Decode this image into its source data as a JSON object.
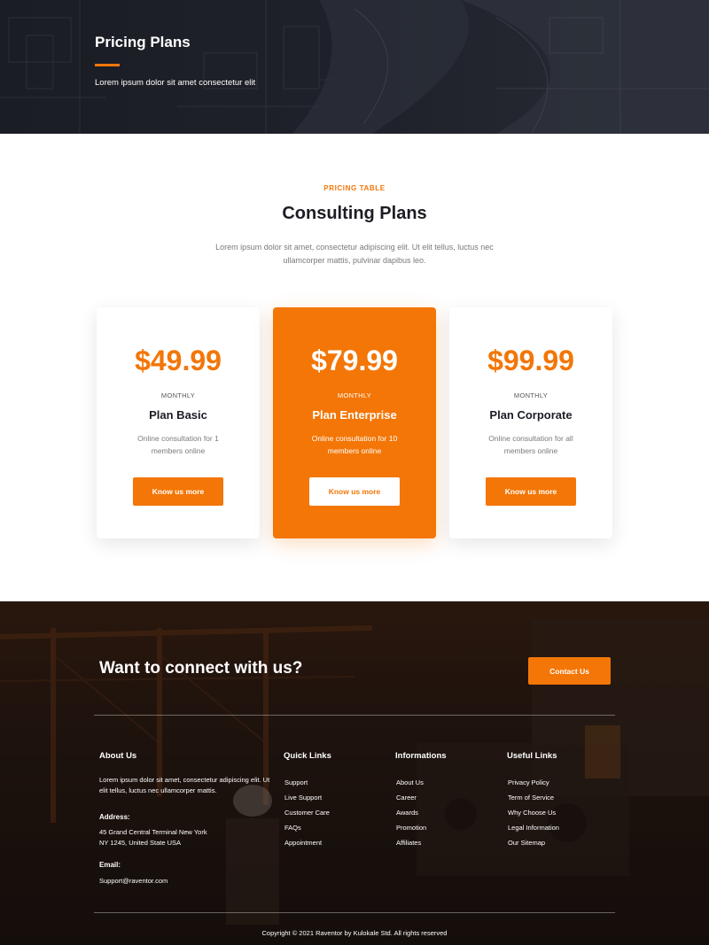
{
  "hero": {
    "title": "Pricing Plans",
    "subtitle": "Lorem ipsum dolor sit amet consectetur elit"
  },
  "pricing": {
    "eyebrow": "PRICING TABLE",
    "title": "Consulting Plans",
    "description": "Lorem ipsum dolor sit amet, consectetur adipiscing elit. Ut elit tellus, luctus nec ullamcorper mattis, pulvinar dapibus leo.",
    "plans": [
      {
        "price": "$49.99",
        "period": "MONTHLY",
        "name": "Plan Basic",
        "description": "Online consultation for 1 members online",
        "button": "Know us more"
      },
      {
        "price": "$79.99",
        "period": "MONTHLY",
        "name": "Plan Enterprise",
        "description": "Online consultation for 10 members online",
        "button": "Know us more"
      },
      {
        "price": "$99.99",
        "period": "MONTHLY",
        "name": "Plan Corporate",
        "description": "Online consultation for all members online",
        "button": "Know us more"
      }
    ]
  },
  "footer": {
    "connect_title": "Want to connect with us?",
    "contact_button": "Contact Us",
    "about": {
      "heading": "About Us",
      "text": "Lorem ipsum dolor sit amet, consectetur adipiscing elit. Ut elit tellus, luctus nec ullamcorper mattis.",
      "address_label": "Address:",
      "address_line1": "45 Grand Central Terminal New York",
      "address_line2": "NY 1245, United State USA",
      "email_label": "Email:",
      "email": "Support@raventor.com"
    },
    "quick_links": {
      "heading": "Quick Links",
      "items": [
        "Support",
        "Live Support",
        "Customer Care",
        "FAQs",
        "Appointment"
      ]
    },
    "informations": {
      "heading": "Informations",
      "items": [
        "About Us",
        "Career",
        "Awards",
        "Promotion",
        "Affiliates"
      ]
    },
    "useful_links": {
      "heading": "Useful Links",
      "items": [
        "Privacy Policy",
        "Term of Service",
        "Why Choose Us",
        "Legal Information",
        "Our Sitemap"
      ]
    },
    "copyright": "Copyright © 2021 Raventor by Kulokale Std. All rights reserved"
  },
  "colors": {
    "accent": "#f37607",
    "dark": "#1c1c24",
    "muted": "#7a7a7a"
  }
}
